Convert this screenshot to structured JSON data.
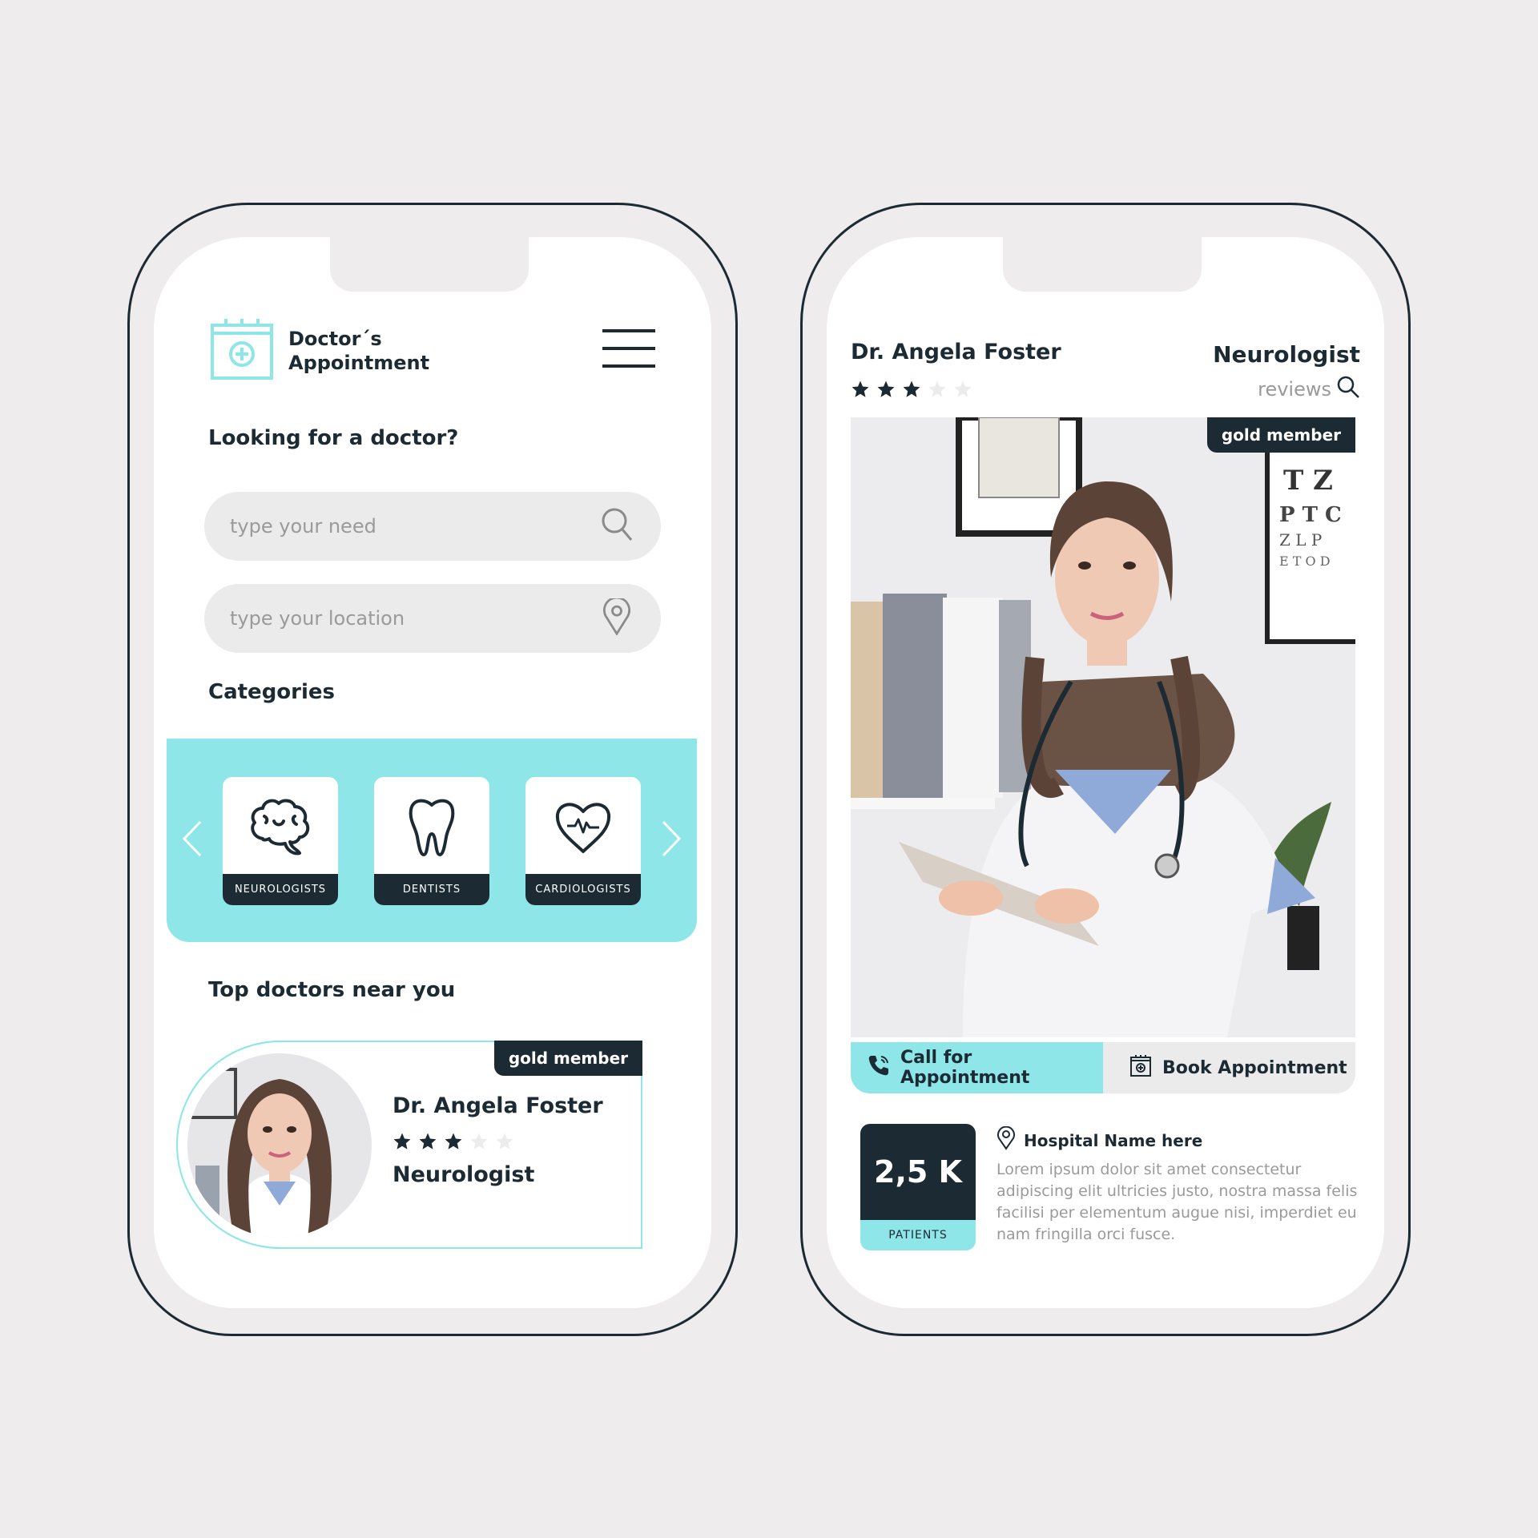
{
  "colors": {
    "accent": "#8ee6e9",
    "dark": "#1c2b33",
    "field_bg": "#ecebec",
    "muted_text": "#9a9a9a",
    "page_bg": "#eeeced"
  },
  "left_phone": {
    "brand": {
      "line1": "Doctor´s",
      "line2": "Appointment",
      "icon": "calendar-plus-icon"
    },
    "menu_icon": "hamburger-menu-icon",
    "looking_heading": "Looking for a doctor?",
    "search": {
      "need_placeholder": "type your need",
      "need_value": "",
      "need_icon": "search-icon",
      "location_placeholder": "type your location",
      "location_value": "",
      "location_icon": "map-pin-icon"
    },
    "categories_heading": "Categories",
    "categories": [
      {
        "label": "NEUROLOGISTS",
        "icon": "brain-icon"
      },
      {
        "label": "DENTISTS",
        "icon": "tooth-icon"
      },
      {
        "label": "CARDIOLOGISTS",
        "icon": "heart-pulse-icon"
      }
    ],
    "top_heading": "Top doctors near you",
    "doctor_card": {
      "badge": "gold member",
      "name": "Dr. Angela Foster",
      "rating": 3,
      "rating_max": 5,
      "specialty": "Neurologist"
    }
  },
  "right_phone": {
    "name": "Dr. Angela Foster",
    "rating": 3,
    "rating_max": 5,
    "specialty": "Neurologist",
    "reviews_label": "reviews",
    "badge": "gold member",
    "call_label": "Call for Appointment",
    "book_label": "Book Appointment",
    "stat": {
      "value": "2,5 K",
      "caption": "PATIENTS"
    },
    "hospital": {
      "name": "Hospital Name here",
      "description": "Lorem ipsum dolor sit amet consectetur adipiscing elit ultricies justo, nostra massa felis facilisi per elementum augue nisi, imperdiet eu nam fringilla orci fusce."
    }
  }
}
